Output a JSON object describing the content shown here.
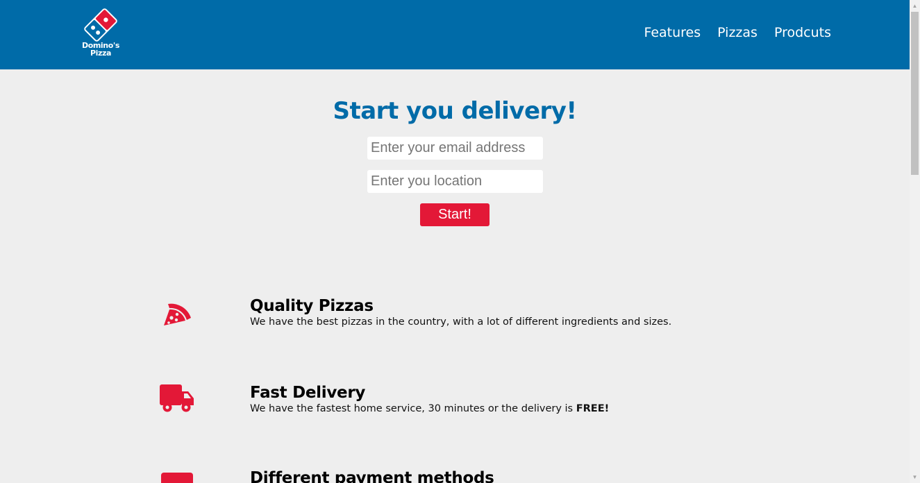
{
  "header": {
    "logo_text_line1": "Domino's",
    "logo_text_line2": "Pizza",
    "nav": [
      "Features",
      "Pizzas",
      "Prodcuts"
    ]
  },
  "hero": {
    "title": "Start you delivery!",
    "email_placeholder": "Enter your email address",
    "location_placeholder": "Enter you location",
    "start_label": "Start!"
  },
  "features": [
    {
      "icon": "pizza-slice-icon",
      "title": "Quality Pizzas",
      "text": "We have the best pizzas in the country, with a lot of different ingredients and sizes."
    },
    {
      "icon": "truck-icon",
      "title": "Fast Delivery",
      "text": "We have the fastest home service, 30 minutes or the delivery is ",
      "text_bold": "FREE!"
    },
    {
      "icon": "credit-card-icon",
      "title": "Different payment methods"
    }
  ],
  "colors": {
    "brand_blue": "#006ba8",
    "accent_red": "#e31837",
    "background": "#eeeeee"
  }
}
